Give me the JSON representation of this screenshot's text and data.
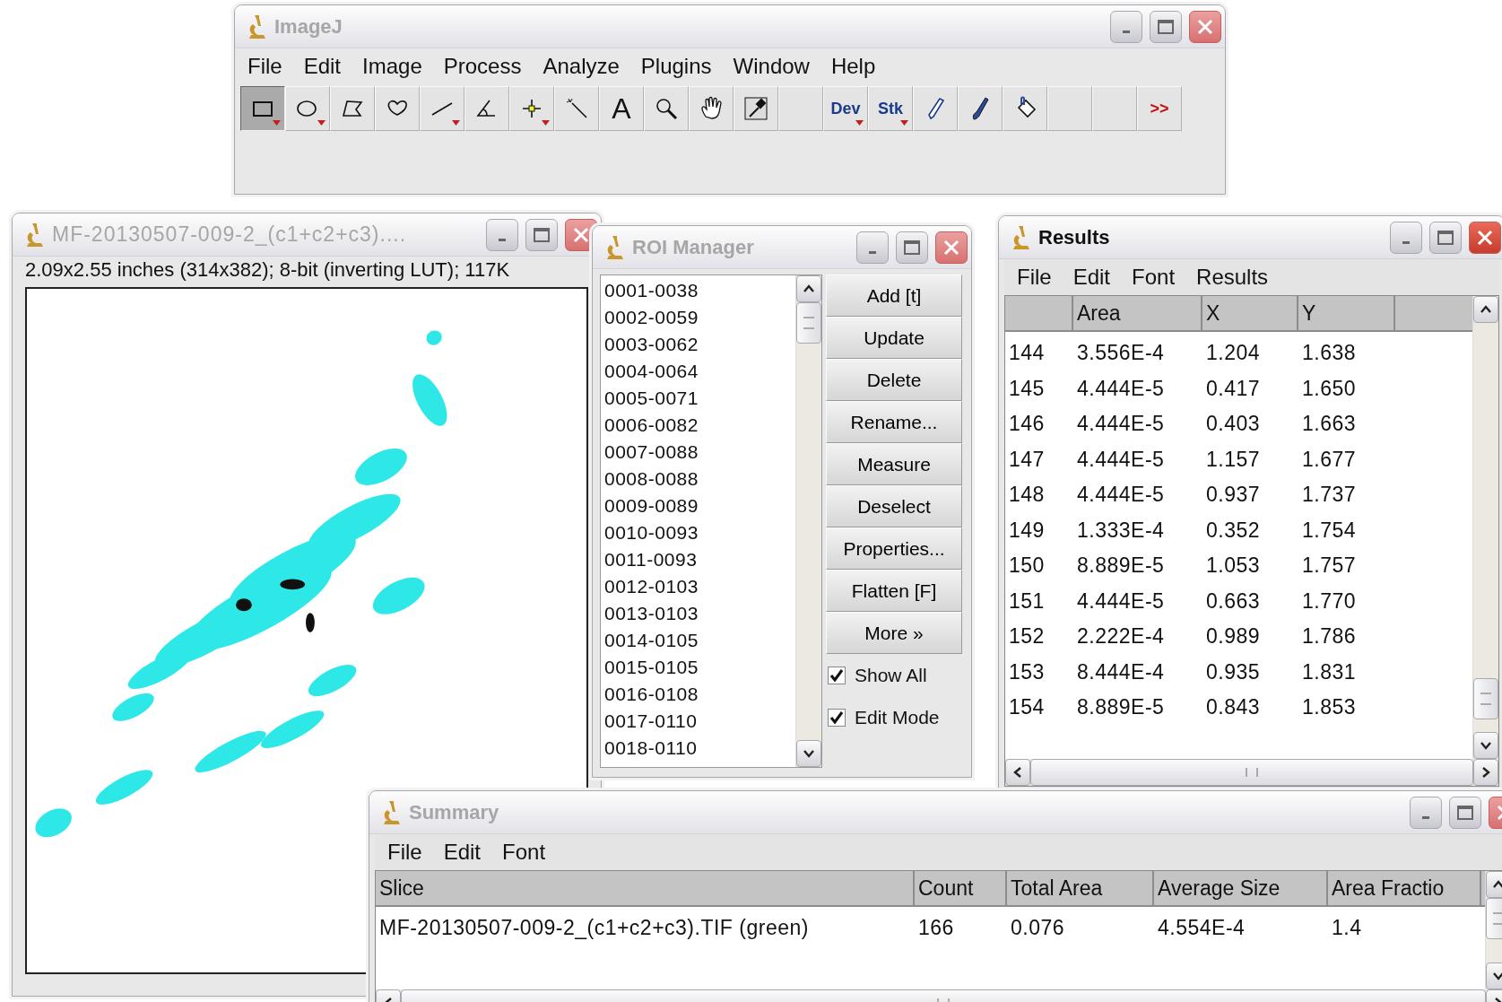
{
  "imagej": {
    "title": "ImageJ",
    "active": false,
    "menu": [
      "File",
      "Edit",
      "Image",
      "Process",
      "Analyze",
      "Plugins",
      "Window",
      "Help"
    ],
    "tools": [
      {
        "selected": true,
        "menu": true
      },
      {
        "selected": false,
        "menu": true
      },
      {
        "selected": false,
        "menu": false
      },
      {
        "selected": false,
        "menu": false
      },
      {
        "selected": false,
        "menu": true
      },
      {
        "selected": false,
        "menu": false
      },
      {
        "selected": false,
        "menu": true
      },
      {
        "selected": false,
        "menu": false
      },
      {
        "selected": false,
        "menu": false,
        "label": "A"
      },
      {
        "selected": false,
        "menu": false
      },
      {
        "selected": false,
        "menu": false
      },
      {
        "selected": false,
        "menu": false
      },
      {
        "selected": false,
        "menu": false
      },
      {
        "selected": false,
        "menu": true,
        "label": "Dev"
      },
      {
        "selected": false,
        "menu": true,
        "label": "Stk"
      },
      {
        "selected": false,
        "menu": false
      },
      {
        "selected": false,
        "menu": false
      },
      {
        "selected": false,
        "menu": false
      },
      {
        "selected": false,
        "menu": false
      },
      {
        "selected": false,
        "menu": false
      },
      {
        "selected": false,
        "menu": false,
        "label": ">>"
      }
    ]
  },
  "image_window": {
    "title": "MF-20130507-009-2_(c1+c2+c3)....",
    "active": false,
    "info": "2.09x2.55 inches (314x382); 8-bit (inverting LUT); 117K"
  },
  "roi_manager": {
    "title": "ROI Manager",
    "active": false,
    "items": [
      {
        "name": "0001-0038",
        "selected": false
      },
      {
        "name": "0002-0059",
        "selected": false
      },
      {
        "name": "0003-0062",
        "selected": false
      },
      {
        "name": "0004-0064",
        "selected": false
      },
      {
        "name": "0005-0071",
        "selected": false
      },
      {
        "name": "0006-0082",
        "selected": false
      },
      {
        "name": "0007-0088",
        "selected": false
      },
      {
        "name": "0008-0088",
        "selected": false
      },
      {
        "name": "0009-0089",
        "selected": false
      },
      {
        "name": "0010-0093",
        "selected": false
      },
      {
        "name": "0011-0093",
        "selected": false
      },
      {
        "name": "0012-0103",
        "selected": false
      },
      {
        "name": "0013-0103",
        "selected": false
      },
      {
        "name": "0014-0105",
        "selected": false
      },
      {
        "name": "0015-0105",
        "selected": false
      },
      {
        "name": "0016-0108",
        "selected": false
      },
      {
        "name": "0017-0110",
        "selected": false
      },
      {
        "name": "0018-0110",
        "selected": false
      }
    ],
    "buttons": [
      "Add [t]",
      "Update",
      "Delete",
      "Rename...",
      "Measure",
      "Deselect",
      "Properties...",
      "Flatten [F]",
      "More »"
    ],
    "options": [
      {
        "label": "Show All",
        "checked": true
      },
      {
        "label": "Edit Mode",
        "checked": true
      }
    ]
  },
  "results": {
    "title": "Results",
    "active": true,
    "menu": [
      "File",
      "Edit",
      "Font",
      "Results"
    ],
    "columns": [
      "",
      "Area",
      "X",
      "Y"
    ],
    "rows": [
      [
        "144",
        "3.556E-4",
        "1.204",
        "1.638"
      ],
      [
        "145",
        "4.444E-5",
        "0.417",
        "1.650"
      ],
      [
        "146",
        "4.444E-5",
        "0.403",
        "1.663"
      ],
      [
        "147",
        "4.444E-5",
        "1.157",
        "1.677"
      ],
      [
        "148",
        "4.444E-5",
        "0.937",
        "1.737"
      ],
      [
        "149",
        "1.333E-4",
        "0.352",
        "1.754"
      ],
      [
        "150",
        "8.889E-5",
        "1.053",
        "1.757"
      ],
      [
        "151",
        "4.444E-5",
        "0.663",
        "1.770"
      ],
      [
        "152",
        "2.222E-4",
        "0.989",
        "1.786"
      ],
      [
        "153",
        "8.444E-4",
        "0.935",
        "1.831"
      ],
      [
        "154",
        "8.889E-5",
        "0.843",
        "1.853"
      ]
    ]
  },
  "summary": {
    "title": "Summary",
    "active": false,
    "menu": [
      "File",
      "Edit",
      "Font"
    ],
    "columns": [
      "Slice",
      "Count",
      "Total Area",
      "Average Size",
      "Area Fractio"
    ],
    "rows": [
      [
        "MF-20130507-009-2_(c1+c2+c3).TIF (green)",
        "166",
        "0.076",
        "4.554E-4",
        "1.4"
      ]
    ]
  }
}
